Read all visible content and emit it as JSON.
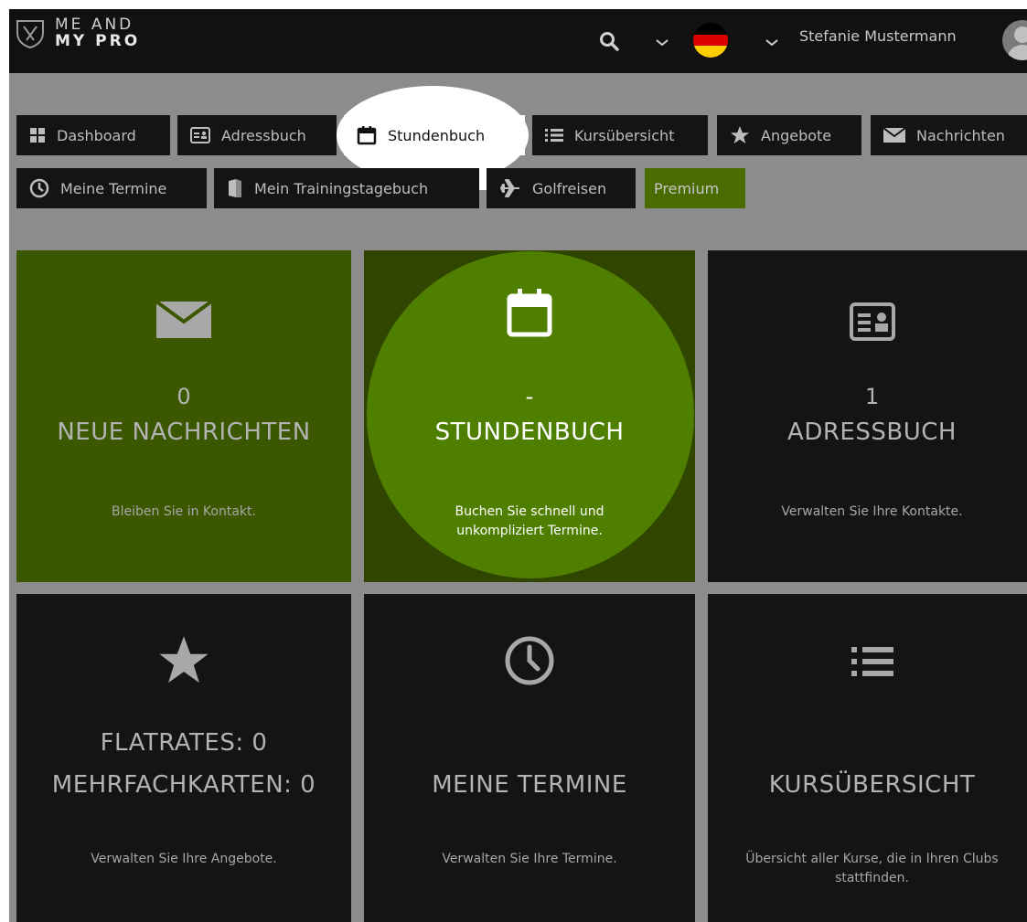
{
  "header": {
    "logo_top": "ME AND",
    "logo_bottom": "MY PRO",
    "user_name": "Stefanie Mustermann",
    "icons": [
      "search-icon",
      "chevron-down-icon",
      "german-flag-icon",
      "chevron-down-icon",
      "avatar"
    ]
  },
  "nav": {
    "row1": [
      {
        "label": "Dashboard",
        "icon": "grid-icon"
      },
      {
        "label": "Adressbuch",
        "icon": "contact-card-icon"
      },
      {
        "label": "Stundenbuch",
        "icon": "calendar-icon",
        "active": true
      },
      {
        "label": "Kursübersicht",
        "icon": "list-icon"
      },
      {
        "label": "Angebote",
        "icon": "star-icon"
      },
      {
        "label": "Nachrichten",
        "icon": "envelope-icon"
      }
    ],
    "row2": [
      {
        "label": "Meine Termine",
        "icon": "clock-icon"
      },
      {
        "label": "Mein Trainingstagebuch",
        "icon": "book-icon"
      },
      {
        "label": "Golfreisen",
        "icon": "airplane-icon"
      },
      {
        "label": "Premium"
      }
    ]
  },
  "tiles": [
    {
      "count": "0",
      "title": "NEUE NACHRICHTEN",
      "desc": "Bleiben Sie in Kontakt.",
      "icon": "envelope-icon"
    },
    {
      "count": "-",
      "title": "STUNDENBUCH",
      "desc": "Buchen Sie schnell und unkompliziert Termine.",
      "icon": "calendar-icon",
      "highlighted": true
    },
    {
      "count": "1",
      "title": "ADRESSBUCH",
      "desc": "Verwalten Sie Ihre Kontakte.",
      "icon": "contact-card-icon"
    },
    {
      "title": "FLATRATES: 0",
      "title2": "MEHRFACHKARTEN: 0",
      "desc": "Verwalten Sie Ihre Angebote.",
      "icon": "star-icon"
    },
    {
      "title": "MEINE TERMINE",
      "desc": "Verwalten Sie Ihre Termine.",
      "icon": "clock-icon"
    },
    {
      "title": "KURSÜBERSICHT",
      "desc": "Übersicht aller Kurse, die in Ihren Clubs stattfinden.",
      "icon": "list-icon"
    }
  ],
  "colors": {
    "overlay_gray": "#8c8c8c",
    "dark": "#141414",
    "green_dim": "#3b5700",
    "green_dark": "#2f4500",
    "green_bright": "#4f7f00",
    "premium": "#4a6b00"
  }
}
